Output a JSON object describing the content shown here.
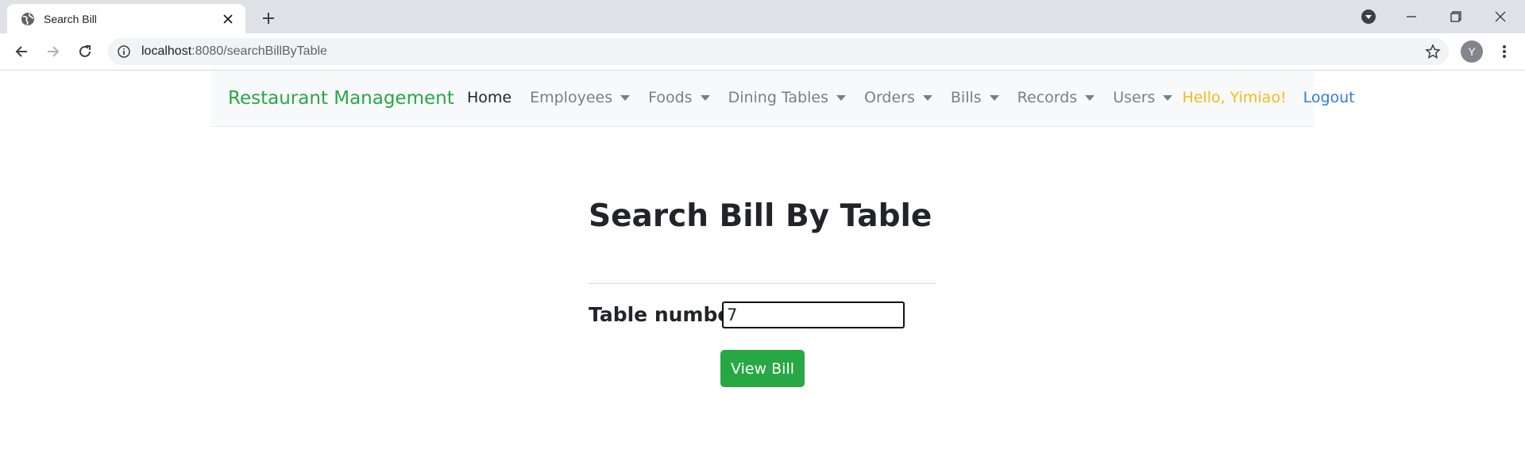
{
  "browser": {
    "tab_title": "Search Bill",
    "url_host": "localhost",
    "url_rest": ":8080/searchBillByTable",
    "profile_initial": "Y"
  },
  "navbar": {
    "brand": "Restaurant Management",
    "links": [
      {
        "label": "Home",
        "dropdown": false
      },
      {
        "label": "Employees",
        "dropdown": true
      },
      {
        "label": "Foods",
        "dropdown": true
      },
      {
        "label": "Dining Tables",
        "dropdown": true
      },
      {
        "label": "Orders",
        "dropdown": true
      },
      {
        "label": "Bills",
        "dropdown": true
      },
      {
        "label": "Records",
        "dropdown": true
      },
      {
        "label": "Users",
        "dropdown": true
      }
    ],
    "greeting": "Hello, Yimiao!",
    "logout": "Logout"
  },
  "page": {
    "title": "Search Bill By Table",
    "table_label": "Table number:",
    "table_value": "7",
    "submit_label": "View Bill"
  },
  "colors": {
    "brand": "#28a745",
    "greeting": "#f6b91b",
    "logout": "#2f7cd8",
    "button": "#28a745"
  }
}
